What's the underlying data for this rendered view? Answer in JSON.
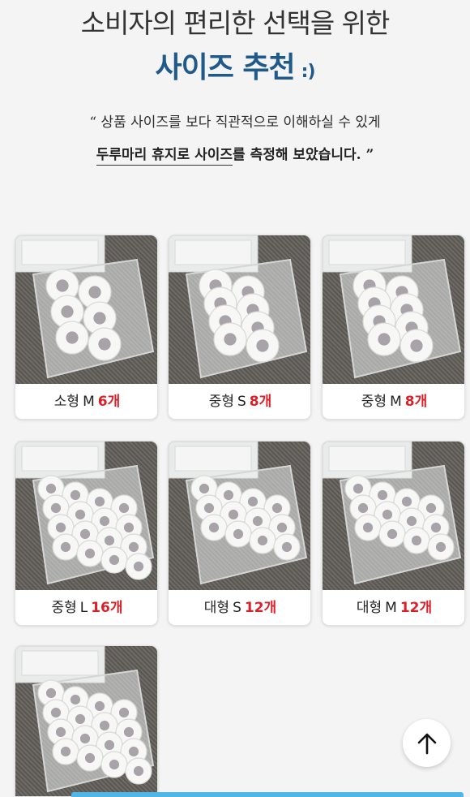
{
  "header": {
    "title_line1": "소비자의 편리한 선택을 위한",
    "title_line2": "사이즈 추천",
    "smiley": ":)",
    "quote_line1": "“ 상품 사이즈를 보다 직관적으로 이해하실 수 있게",
    "quote_line2_underlined": "두루마리 휴지로 사이즈",
    "quote_line2_rest": "를 측정해 보았습니다. ”"
  },
  "cards": [
    {
      "type": "소형",
      "size": "M",
      "count": "6개",
      "roll_count": 6
    },
    {
      "type": "중형",
      "size": "S",
      "count": "8개",
      "roll_count": 8
    },
    {
      "type": "중형",
      "size": "M",
      "count": "8개",
      "roll_count": 8
    },
    {
      "type": "중형",
      "size": "L",
      "count": "16개",
      "roll_count": 16
    },
    {
      "type": "대형",
      "size": "S",
      "count": "12개",
      "roll_count": 12
    },
    {
      "type": "대형",
      "size": "M",
      "count": "12개",
      "roll_count": 12
    },
    {
      "type": "",
      "size": "",
      "count": "",
      "roll_count": 16
    }
  ],
  "icons": {
    "scroll_top": "arrow-up-icon"
  },
  "colors": {
    "title_blue": "#1f5a8a",
    "count_red": "#d8222a",
    "bottom_bar": "#4fb6e8"
  }
}
